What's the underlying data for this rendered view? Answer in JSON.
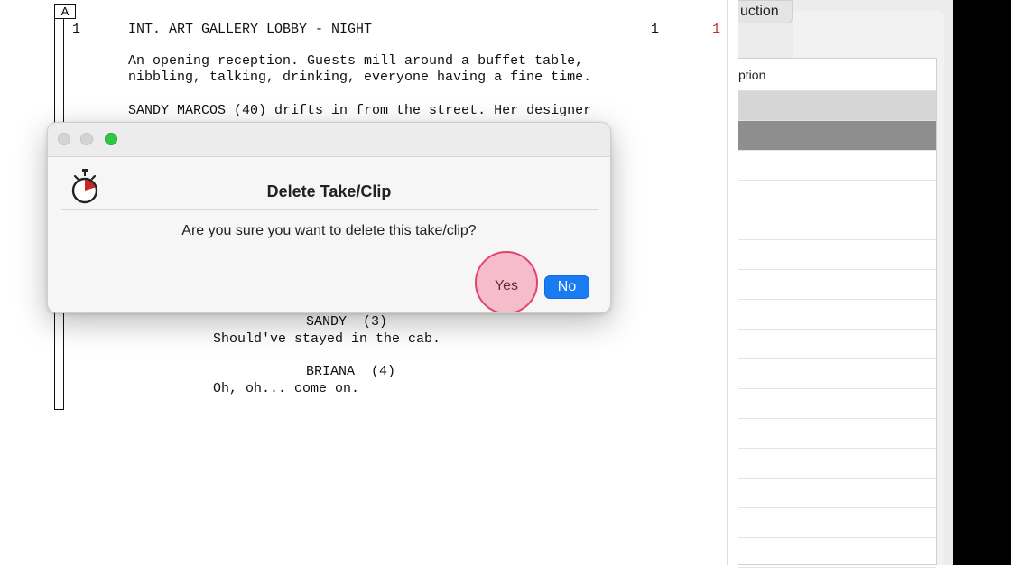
{
  "script": {
    "revision_letter": "A",
    "scene_number_left": "1",
    "scene_heading": "INT. ART GALLERY LOBBY - NIGHT",
    "scene_number_right": "1",
    "scene_number_right_red": "1",
    "action_line_1": "An opening reception. Guests mill around a buffet table,",
    "action_line_2": "nibbling, talking, drinking, everyone having a fine time.",
    "action_line_3": "SANDY MARCOS (40) drifts in from the street. Her designer",
    "character_1": "SANDY  (3)",
    "dialogue_1": "Should've stayed in the cab.",
    "character_2": "BRIANA  (4)",
    "dialogue_2": "Oh, oh... come on."
  },
  "right_panel": {
    "tab_label": "uction",
    "column_header": "ption",
    "selected_row_color": "#d6d6d6",
    "highlighted_row_color": "#8e8e8e"
  },
  "dialog": {
    "title": "Delete Take/Clip",
    "message": "Are you sure you want to delete this take/clip?",
    "yes_label": "Yes",
    "no_label": "No",
    "icon": "stopwatch-icon",
    "primary_color": "#1a7cf2",
    "highlight_color": "#e5416e"
  }
}
